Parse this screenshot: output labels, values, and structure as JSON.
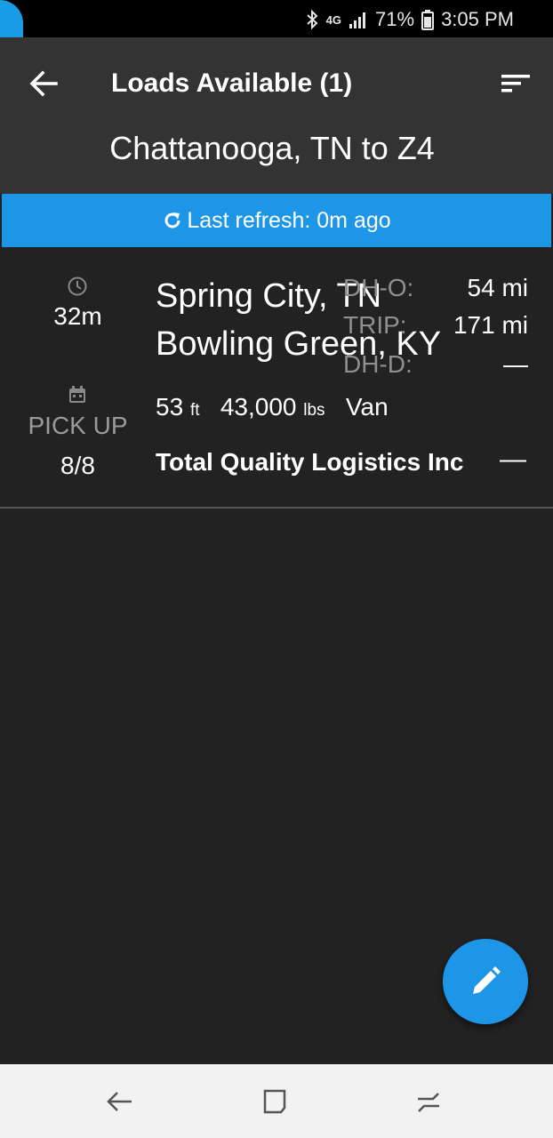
{
  "status_bar": {
    "network_label": "4G",
    "battery": "71%",
    "time": "3:05 PM"
  },
  "header": {
    "title": "Loads Available (1)",
    "route": "Chattanooga, TN to Z4"
  },
  "refresh": {
    "text": "Last refresh: 0m ago"
  },
  "load": {
    "age": "32m",
    "pickup_label": "PICK UP",
    "pickup_date": "8/8",
    "origin": "Spring City, TN",
    "destination": "Bowling Green, KY",
    "dh_o_label": "DH-O:",
    "dh_o_value": "54 mi",
    "trip_label": "TRIP:",
    "trip_value": "171 mi",
    "dh_d_label": "DH-D:",
    "dh_d_value": "—",
    "length": "53",
    "length_unit": "ft",
    "weight": "43,000",
    "weight_unit": "lbs",
    "equipment": "Van",
    "company": "Total Quality Logistics Inc",
    "rate": "—"
  },
  "colors": {
    "accent": "#1e96e8",
    "background": "#222222",
    "header": "#333333"
  }
}
